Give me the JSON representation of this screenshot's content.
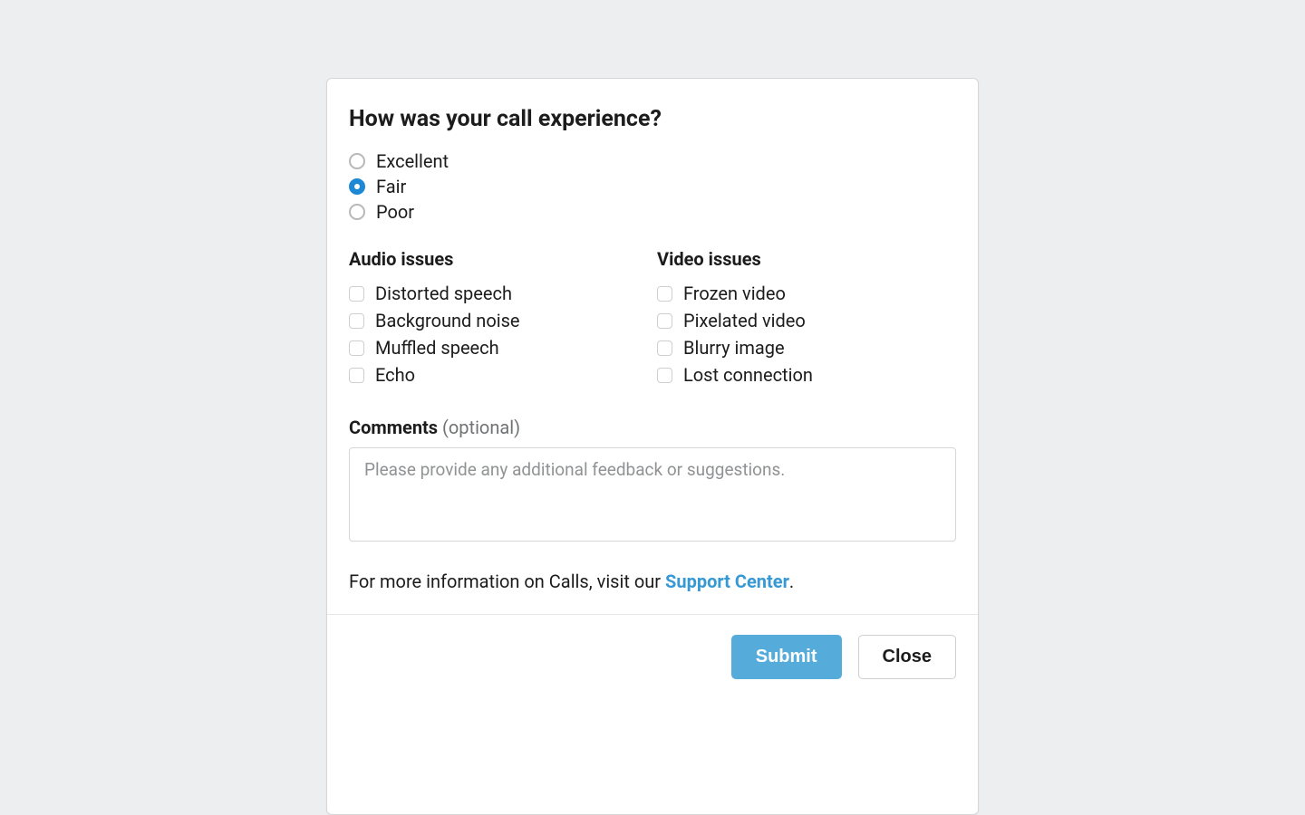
{
  "title": "How was your call experience?",
  "ratings": [
    {
      "label": "Excellent",
      "selected": false
    },
    {
      "label": "Fair",
      "selected": true
    },
    {
      "label": "Poor",
      "selected": false
    }
  ],
  "audio": {
    "heading": "Audio issues",
    "items": [
      "Distorted speech",
      "Background noise",
      "Muffled speech",
      "Echo"
    ]
  },
  "video": {
    "heading": "Video issues",
    "items": [
      "Frozen video",
      "Pixelated video",
      "Blurry image",
      "Lost connection"
    ]
  },
  "comments": {
    "heading_bold": "Comments",
    "heading_opt": "(optional)",
    "placeholder": "Please provide any additional feedback or suggestions."
  },
  "support": {
    "prefix": "For more information on Calls, visit our ",
    "link_text": "Support Center",
    "suffix": "."
  },
  "footer": {
    "submit": "Submit",
    "close": "Close"
  }
}
